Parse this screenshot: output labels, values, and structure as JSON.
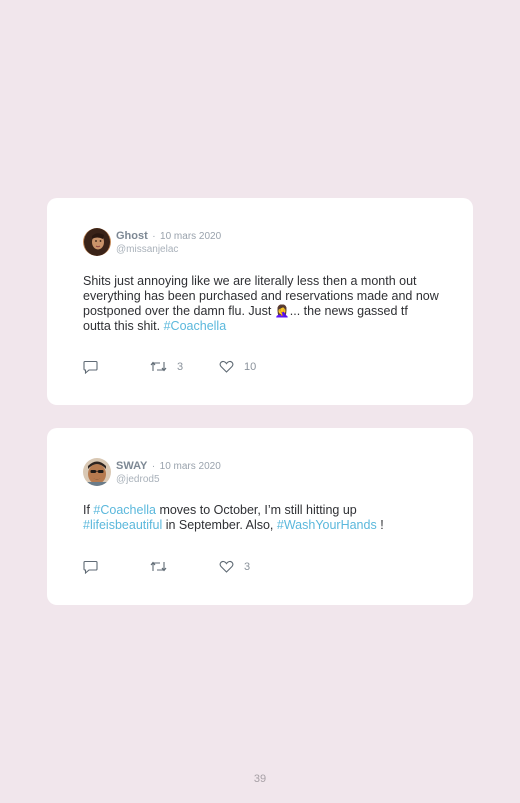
{
  "tweets": [
    {
      "name": "Ghost",
      "separator": "·",
      "date": "10 mars 2020",
      "handle": "@missanjelac",
      "text_1": "Shits just annoying like we are literally less then a month out everything has been purchased and reservations made and now postponed over the damn flu. Just ",
      "emoji": "🤦‍♀️",
      "text_2": "... the news gassed tf outta this shit. ",
      "hashtag_1": "#Coachella",
      "retweets": "3",
      "likes": "10"
    },
    {
      "name": "SWAY",
      "separator": "·",
      "date": "10 mars 2020",
      "handle": "@jedrod5",
      "text_1": "If ",
      "hashtag_1": "#Coachella",
      "text_2": " moves to October, I’m still hitting up ",
      "hashtag_2": "#lifeisbeautiful",
      "text_3": " in September. Also, ",
      "hashtag_3": "#WashYourHands",
      "text_4": " !",
      "retweets": "",
      "likes": "3"
    }
  ],
  "icons": {
    "reply": "reply-icon",
    "retweet": "retweet-icon",
    "like": "heart-icon"
  },
  "colors": {
    "background": "#f1e6ec",
    "card": "#ffffff",
    "hashtag": "#5bb8dc"
  },
  "page_number": "39"
}
